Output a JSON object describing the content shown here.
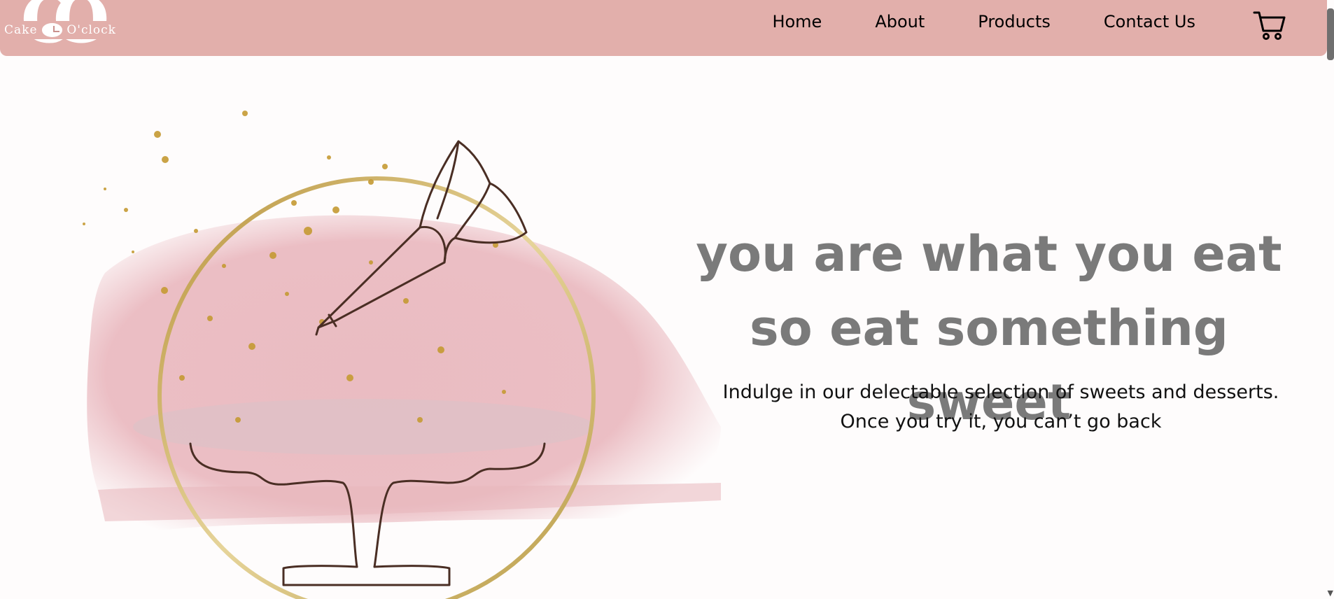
{
  "brand": {
    "monogram_left": "C",
    "monogram_right": "O",
    "name_left": "Cake",
    "name_right": "O'clock"
  },
  "nav": {
    "items": [
      {
        "label": "Home"
      },
      {
        "label": "About"
      },
      {
        "label": "Products"
      },
      {
        "label": "Contact Us"
      }
    ],
    "cart_icon": "cart-icon"
  },
  "hero": {
    "headline": "you are what you eat so eat something sweet",
    "subtext": "Indulge in our delectable selection of sweets and desserts. Once you try it, you can’t go back",
    "illustration": "piping-bag-cake-stand-illustration"
  },
  "colors": {
    "navbar": "#e2afab",
    "headline": "#7a7a7a",
    "background": "#fefcfc",
    "gold": "#c9a84c",
    "pink_wash": "#e9b9bf"
  }
}
